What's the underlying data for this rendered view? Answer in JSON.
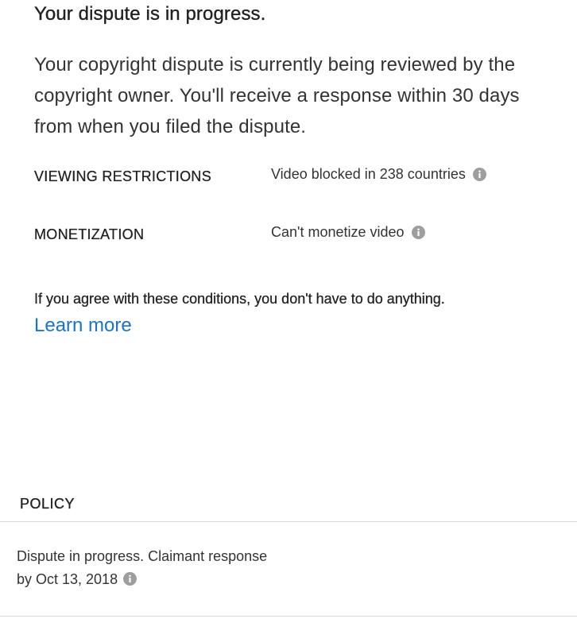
{
  "header": {
    "title": "Your dispute is in progress.",
    "description": "Your copyright dispute is currently being reviewed by the copyright owner. You'll receive a response within 30 days from when you filed the dispute."
  },
  "restrictions": [
    {
      "label": "VIEWING RESTRICTIONS",
      "value": "Video blocked in 238 countries",
      "icon": "info-icon"
    },
    {
      "label": "MONETIZATION",
      "value": "Can't monetize video",
      "icon": "info-icon"
    }
  ],
  "notice": {
    "text": "If you agree with these conditions, you don't have to do anything.",
    "link_label": "Learn more"
  },
  "policy": {
    "heading": "POLICY",
    "status_text": "Dispute in progress. Claimant response by Oct 13, 2018",
    "icon": "info-icon"
  },
  "colors": {
    "link": "#1a73c8",
    "icon": "#9e9e9e",
    "divider": "#d8d8d8"
  }
}
